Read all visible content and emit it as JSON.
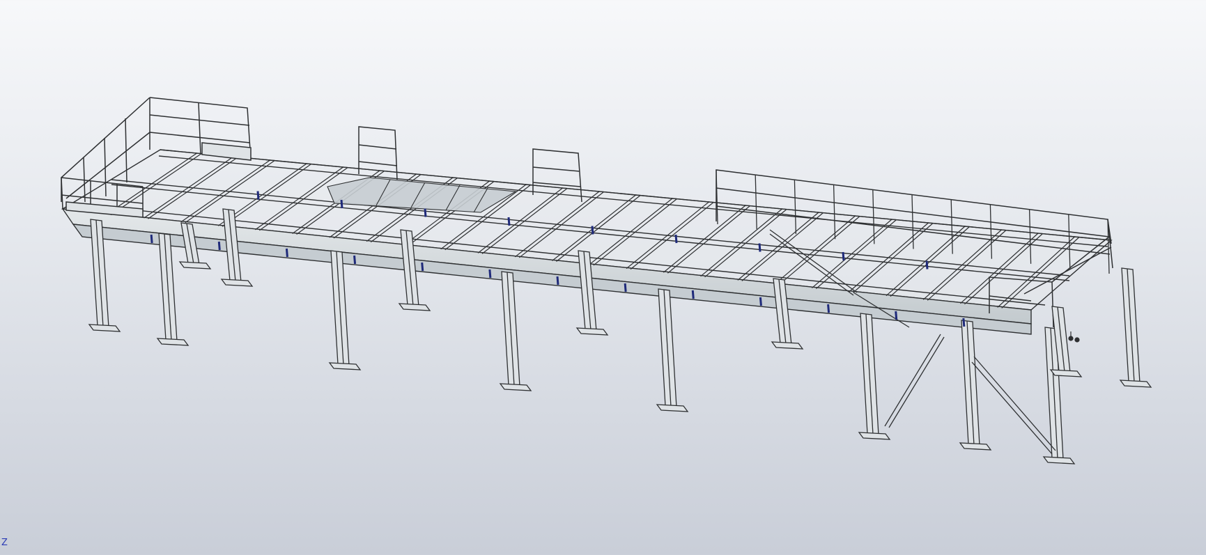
{
  "viewport": {
    "background_top": "#f7f8fa",
    "background_bottom": "#c9ced8",
    "line_color": "#2e3032",
    "steel_fill": "#dfe3e6",
    "steel_shade": "#b7bec4",
    "accent_blue": "#1f2a7a"
  },
  "triad": {
    "axis_label": "Z"
  },
  "model": {
    "description_icon": "steel-platform-model"
  }
}
